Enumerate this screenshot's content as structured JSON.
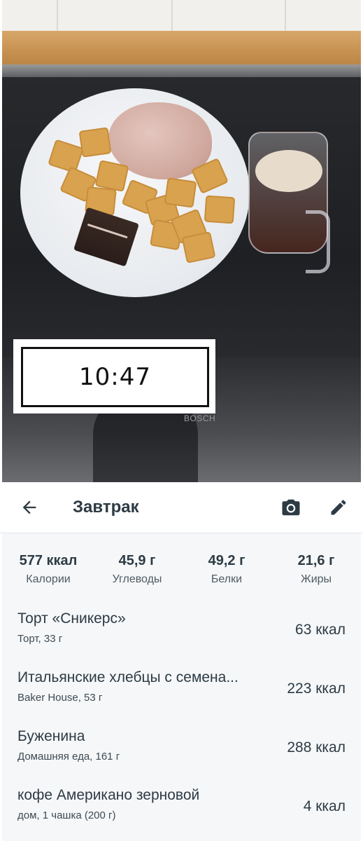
{
  "photo": {
    "time": "10:47",
    "brand_mark": "BOSCH"
  },
  "toolbar": {
    "title": "Завтрак",
    "icons": {
      "back": "arrow-back-icon",
      "camera": "camera-icon",
      "edit": "pencil-icon"
    }
  },
  "summary": [
    {
      "value": "577 ккал",
      "label": "Калории"
    },
    {
      "value": "45,9 г",
      "label": "Углеводы"
    },
    {
      "value": "49,2 г",
      "label": "Белки"
    },
    {
      "value": "21,6 г",
      "label": "Жиры"
    }
  ],
  "items": [
    {
      "name": "Торт «Сникерс»",
      "sub": "Торт, 33 г",
      "kcal": "63 ккал"
    },
    {
      "name": "Итальянские хлебцы с семена...",
      "sub": "Baker House, 53 г",
      "kcal": "223 ккал"
    },
    {
      "name": "Буженина",
      "sub": "Домашняя еда, 161 г",
      "kcal": "288 ккал"
    },
    {
      "name": "кофе Американо зерновой",
      "sub": "дом, 1 чашка (200 г)",
      "kcal": "4 ккал"
    }
  ],
  "colors": {
    "text_dark": "#2d3b44",
    "content_bg": "#f5f7f9"
  }
}
